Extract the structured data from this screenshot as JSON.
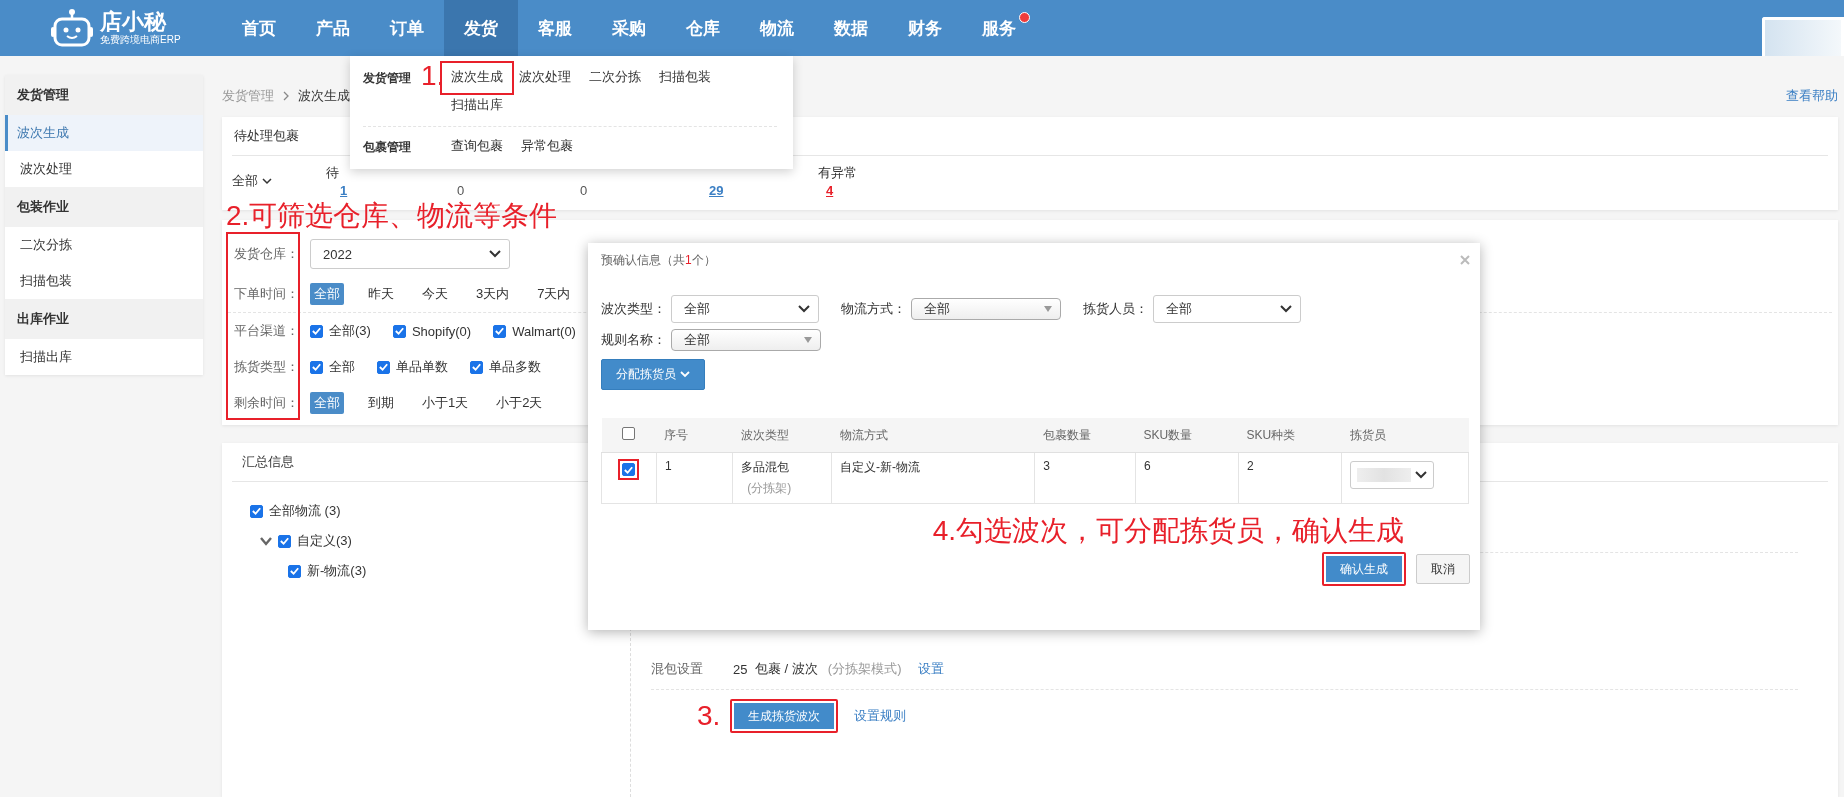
{
  "logo": {
    "name": "店小秘",
    "tagline": "免费跨境电商ERP"
  },
  "nav": [
    {
      "label": "首页",
      "selected": false,
      "notification": false
    },
    {
      "label": "产品",
      "selected": false,
      "notification": false
    },
    {
      "label": "订单",
      "selected": false,
      "notification": false
    },
    {
      "label": "发货",
      "selected": true,
      "notification": false
    },
    {
      "label": "客服",
      "selected": false,
      "notification": false
    },
    {
      "label": "采购",
      "selected": false,
      "notification": false
    },
    {
      "label": "仓库",
      "selected": false,
      "notification": false
    },
    {
      "label": "物流",
      "selected": false,
      "notification": false
    },
    {
      "label": "数据",
      "selected": false,
      "notification": false
    },
    {
      "label": "财务",
      "selected": false,
      "notification": false
    },
    {
      "label": "服务",
      "selected": false,
      "notification": true
    }
  ],
  "dropdown_menu": {
    "annotation": "1.",
    "groups": [
      {
        "title": "发货管理",
        "items": [
          {
            "label": "波次生成",
            "highlighted": true
          },
          {
            "label": "波次处理",
            "highlighted": false
          },
          {
            "label": "二次分拣",
            "highlighted": false
          },
          {
            "label": "扫描包装",
            "highlighted": false
          },
          {
            "label": "扫描出库",
            "highlighted": false
          }
        ]
      },
      {
        "title": "包裹管理",
        "items": [
          {
            "label": "查询包裹",
            "highlighted": false
          },
          {
            "label": "异常包裹",
            "highlighted": false
          }
        ]
      }
    ]
  },
  "sidebar": {
    "groups": [
      {
        "title": "发货管理",
        "items": [
          {
            "label": "波次生成",
            "selected": true
          },
          {
            "label": "波次处理",
            "selected": false
          }
        ]
      },
      {
        "title": "包装作业",
        "items": [
          {
            "label": "二次分拣",
            "selected": false
          },
          {
            "label": "扫描包装",
            "selected": false
          }
        ]
      },
      {
        "title": "出库作业",
        "items": [
          {
            "label": "扫描出库",
            "selected": false
          }
        ]
      }
    ]
  },
  "breadcrumb": [
    "发货管理",
    "波次生成"
  ],
  "help_link": "查看帮助",
  "pending_card": {
    "title": "待处理包裹",
    "filter": "全部",
    "stats": [
      {
        "label": "待",
        "value": "1",
        "kind": "link"
      },
      {
        "value": "0",
        "kind": "plain"
      },
      {
        "value": "0",
        "kind": "plain"
      },
      {
        "value": "29",
        "kind": "link"
      },
      {
        "label": "有异常",
        "value": "4",
        "kind": "alert"
      }
    ]
  },
  "filters": {
    "annotation": "2.可筛选仓库、物流等条件",
    "highlighted": true,
    "rows": [
      {
        "kind": "select",
        "label": "发货仓库：",
        "value": "2022"
      },
      {
        "kind": "tags",
        "label": "下单时间：",
        "options": [
          {
            "label": "全部",
            "selected": true
          },
          {
            "label": "昨天",
            "selected": false
          },
          {
            "label": "今天",
            "selected": false
          },
          {
            "label": "3天内",
            "selected": false
          },
          {
            "label": "7天内",
            "selected": false
          }
        ]
      },
      {
        "kind": "checkboxes",
        "label": "平台渠道：",
        "options": [
          {
            "label": "全部(3)",
            "checked": true
          },
          {
            "label": "Shopify(0)",
            "checked": true
          },
          {
            "label": "Walmart(0)",
            "checked": true
          }
        ]
      },
      {
        "kind": "checkboxes",
        "label": "拣货类型：",
        "options": [
          {
            "label": "全部",
            "checked": true
          },
          {
            "label": "单品单数",
            "checked": true
          },
          {
            "label": "单品多数",
            "checked": true
          }
        ]
      },
      {
        "kind": "tags",
        "label": "剩余时间：",
        "options": [
          {
            "label": "全部",
            "selected": true
          },
          {
            "label": "到期",
            "selected": false
          },
          {
            "label": "小于1天",
            "selected": false
          },
          {
            "label": "小于2天",
            "selected": false
          }
        ]
      }
    ]
  },
  "summary": {
    "title": "汇总信息",
    "tree": [
      {
        "label": "全部物流 (3)",
        "checked": true,
        "children": [
          {
            "label": "自定义(3)",
            "checked": true,
            "expanded": true,
            "children": [
              {
                "label": "新-物流(3)",
                "checked": true
              }
            ]
          }
        ]
      }
    ],
    "mix_setting": {
      "label": "混包设置",
      "count": "25",
      "unit": "包裹 / 波次",
      "mode": "(分拣架模式)",
      "link": "设置"
    },
    "generate_button": {
      "label": "生成拣货波次",
      "highlighted": true,
      "annotation": "3."
    },
    "rule_link": "设置规则"
  },
  "modal": {
    "title": "预确认信息",
    "count_open": "（共",
    "count": "1",
    "count_close": "个）",
    "filters": [
      {
        "label": "波次类型：",
        "value": "全部",
        "kind": "native"
      },
      {
        "label": "物流方式：",
        "value": "全部",
        "kind": "combo"
      },
      {
        "label": "拣货人员：",
        "value": "全部",
        "kind": "native"
      },
      {
        "label": "规则名称：",
        "value": "全部",
        "kind": "combo"
      }
    ],
    "assign_button": "分配拣货员",
    "table": {
      "all_checked": false,
      "columns": [
        "序号",
        "波次类型",
        "物流方式",
        "包裹数量",
        "SKU数量",
        "SKU种类",
        "拣货员"
      ],
      "rows": [
        {
          "checked": true,
          "highlighted": true,
          "cells": [
            "1",
            "多品混包",
            "自定义-新-物流",
            "3",
            "6",
            "2"
          ],
          "subtype": "(分拣架)"
        }
      ]
    },
    "annotation": "4.勾选波次，可分配拣货员，确认生成",
    "confirm": {
      "label": "确认生成",
      "highlighted": true
    },
    "cancel": "取消"
  }
}
